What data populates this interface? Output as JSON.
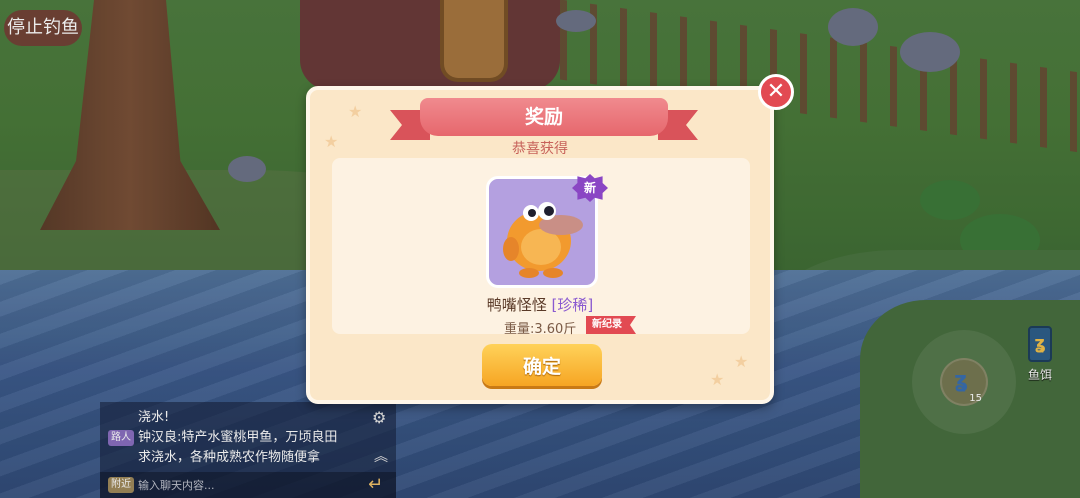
{
  "hud": {
    "stop_fishing": "停止钓鱼",
    "bait_label": "鱼饵",
    "bait_count": "15"
  },
  "dialog": {
    "title": "奖励",
    "subtitle": "恭喜获得",
    "close": "✕",
    "item": {
      "name": "鸭嘴怪怪",
      "rarity": "[珍稀]",
      "new_badge": "新",
      "weight": "重量:3.60斤",
      "record_badge": "新纪录"
    },
    "confirm": "确定"
  },
  "chat": {
    "messages": [
      {
        "tag": "",
        "text": "浇水!"
      },
      {
        "tag": "路人",
        "text": "钟汉良:特产水蜜桃甲鱼，万顷良田"
      },
      {
        "tag": "",
        "text": "求浇水，各种成熟农作物随便拿"
      }
    ],
    "input_tag": "附近",
    "input_placeholder": "输入聊天内容..."
  }
}
